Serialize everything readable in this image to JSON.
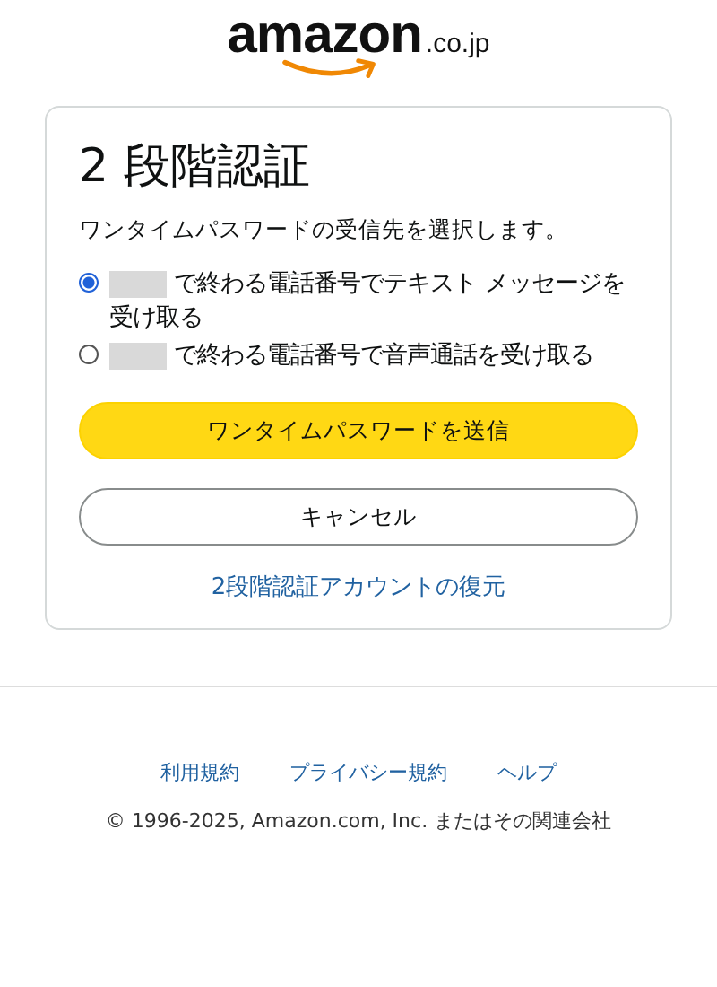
{
  "logo": {
    "wordmark": "amazon",
    "suffix": ".co.jp"
  },
  "card": {
    "title": "2 段階認証",
    "instruction": "ワンタイムパスワードの受信先を選択します。",
    "options": [
      {
        "selected": true,
        "label": "で終わる電話番号でテキスト メッセージを受け取る"
      },
      {
        "selected": false,
        "label": "で終わる電話番号で音声通話を受け取る"
      }
    ],
    "primary_button": "ワンタイムパスワードを送信",
    "secondary_button": "キャンセル",
    "recovery_link": "2段階認証アカウントの復元"
  },
  "footer": {
    "links": [
      "利用規約",
      "プライバシー規約",
      "ヘルプ"
    ],
    "copyright": "© 1996-2025, Amazon.com, Inc. またはその関連会社"
  }
}
